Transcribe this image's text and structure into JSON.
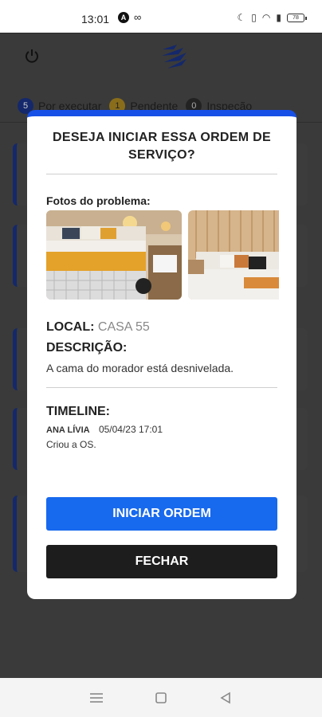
{
  "status_bar": {
    "time": "13:01",
    "battery": "78"
  },
  "tabs": [
    {
      "count": "5",
      "label": "Por executar",
      "color": "#14286b"
    },
    {
      "count": "1",
      "label": "Pendente",
      "color": "#8a6d1a"
    },
    {
      "count": "0",
      "label": "Inspeção",
      "color": "#222222"
    }
  ],
  "modal": {
    "accent_color": "#1750e6",
    "title": "DESEJA INICIAR ESSA ORDEM DE SERVIÇO?",
    "photos_label": "Fotos do problema:",
    "local_label": "LOCAL:",
    "local_value": "CASA 55",
    "description_label": "DESCRIÇÃO:",
    "description_text": "A cama do morador está desnivelada.",
    "timeline_label": "TIMELINE:",
    "timeline": [
      {
        "user": "ANA LÍVIA",
        "date": "05/04/23 17:01",
        "action": "Criou a OS."
      }
    ],
    "start_button": "INICIAR ORDEM",
    "close_button": "FECHAR"
  },
  "nav": {
    "icons": [
      "recent-apps-icon",
      "home-icon",
      "back-icon"
    ]
  }
}
